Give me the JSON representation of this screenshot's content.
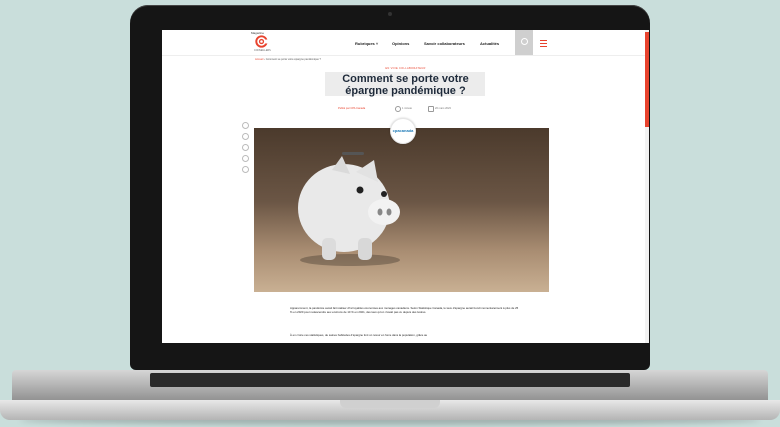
{
  "nav": {
    "logo_label": "Magazine",
    "logo_sub": "CONSEILLERS",
    "items": [
      "Rubriques ˅",
      "Opinions",
      "Savoir collaborateurs",
      "Actualités"
    ]
  },
  "breadcrumb": {
    "home": "Accueil",
    "current": "Comment se porte votre épargne pandémique ?"
  },
  "article": {
    "category": "EN VOIE COLLABORATEUR",
    "title_line1": "Comment se porte votre",
    "title_line2": "épargne pandémique ?",
    "author": "Publié par CPA Canada",
    "read_time": "1 minute",
    "date": "20 mars 2023",
    "sponsor": "cpacanada",
    "paragraph1": "Apparemment, la pandémie aurait fait réaliser d'incroyables économies aux ménages canadiens. Selon Statistique Canada, le taux d'épargne aurait bondi momentanément à plus de 25 % en 2020 pour redescendre aux environs de 10 % en 2021, des taux qu'on n'avait pas vu depuis des lustres.",
    "paragraph2": "À en croire ces statistiques, de saines habitudes d'épargne font un retour en force dans la population, grâce au"
  },
  "colors": {
    "accent": "#e8432e",
    "title": "#1e2a3a",
    "background": "#c9dedb"
  }
}
